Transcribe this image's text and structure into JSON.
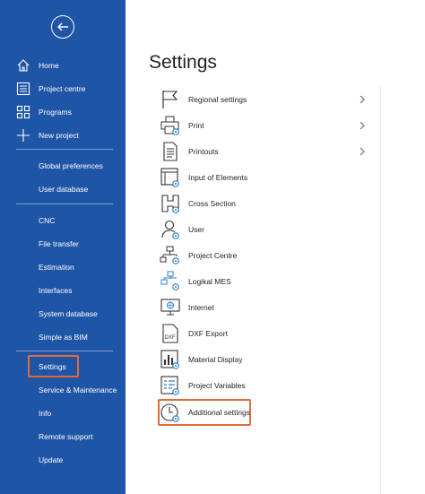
{
  "sidebar": {
    "back_icon": "arrow-left-circle-icon",
    "top_items": [
      {
        "label": "Home",
        "icon": "home-icon"
      },
      {
        "label": "Project centre",
        "icon": "project-centre-icon"
      },
      {
        "label": "Programs",
        "icon": "grid-icon"
      },
      {
        "label": "New project",
        "icon": "plus-icon"
      }
    ],
    "group1": [
      "Global preferences",
      "User database"
    ],
    "group2": [
      "CNC",
      "File transfer",
      "Estimation",
      "Interfaces",
      "System database",
      "Simple as BIM"
    ],
    "group3": [
      "Settings",
      "Service & Maintenance",
      "Info",
      "Remote support",
      "Update"
    ],
    "active": "Settings",
    "colors": {
      "background": "#1f55a6",
      "highlight": "#e06a3a"
    }
  },
  "main": {
    "title": "Settings",
    "items": [
      {
        "label": "Regional settings",
        "icon": "flag-icon",
        "has_submenu": true
      },
      {
        "label": "Print",
        "icon": "printer-gear-icon",
        "has_submenu": true
      },
      {
        "label": "Printouts",
        "icon": "document-icon",
        "has_submenu": true
      },
      {
        "label": "Input of Elements",
        "icon": "window-gear-icon",
        "has_submenu": false
      },
      {
        "label": "Cross Section",
        "icon": "cross-section-icon",
        "has_submenu": false
      },
      {
        "label": "User",
        "icon": "user-gear-icon",
        "has_submenu": false
      },
      {
        "label": "Project Centre",
        "icon": "hierarchy-gear-icon",
        "has_submenu": false
      },
      {
        "label": "Logikal MES",
        "icon": "network-gear-icon",
        "has_submenu": false
      },
      {
        "label": "Internet",
        "icon": "monitor-globe-icon",
        "has_submenu": false
      },
      {
        "label": "DXF Export",
        "icon": "dxf-file-icon",
        "has_submenu": false
      },
      {
        "label": "Material Display",
        "icon": "chart-gear-icon",
        "has_submenu": false
      },
      {
        "label": "Project Variables",
        "icon": "list-gear-icon",
        "has_submenu": false
      },
      {
        "label": "Additional settings",
        "icon": "clock-gear-icon",
        "has_submenu": false
      }
    ],
    "highlighted": "Additional settings"
  }
}
